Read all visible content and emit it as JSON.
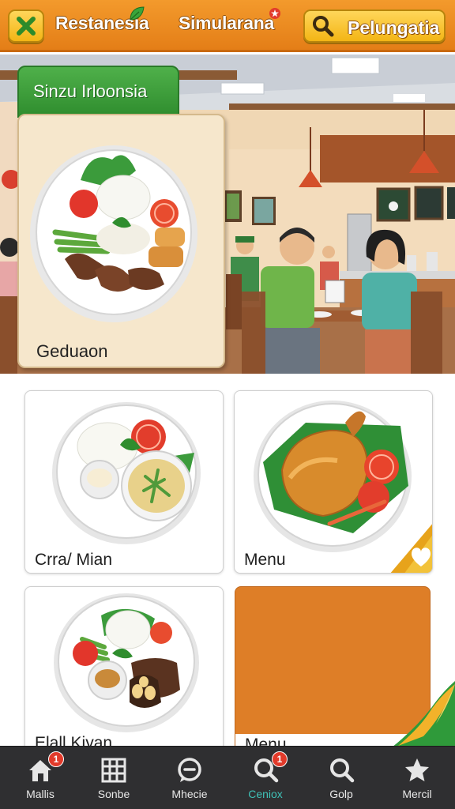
{
  "header": {
    "close_icon": "close-x-icon",
    "title_left": "Restanesia",
    "title_center": "Simularana",
    "search_label": "Pelungatia",
    "search_icon": "search-icon",
    "accent": "#e8861f",
    "button_color": "#f3b515"
  },
  "hero": {
    "tab_label": "Sinzu Irloonsia",
    "card_caption": "Geduaon",
    "tab_color": "#3c9e3a"
  },
  "grid": {
    "cards": [
      {
        "caption": "Crra/ Mian",
        "icon": "rice-plate-icon"
      },
      {
        "caption": "Menu",
        "icon": "roast-chicken-icon",
        "corner_icon": "heart-icon"
      },
      {
        "caption": "Elall Kiyan",
        "icon": "satay-plate-icon"
      },
      {
        "caption": "Menu",
        "color": "#de7e27"
      }
    ]
  },
  "nav": {
    "items": [
      {
        "label": "Mallis",
        "icon": "home-icon",
        "badge": "1"
      },
      {
        "label": "Sonbe",
        "icon": "grid-icon"
      },
      {
        "label": "Mhecie",
        "icon": "chat-icon"
      },
      {
        "label": "Ceniox",
        "icon": "search-icon",
        "badge": "1",
        "active": true
      },
      {
        "label": "Golp",
        "icon": "search-icon"
      },
      {
        "label": "Mercil",
        "icon": "star-icon"
      }
    ],
    "active_color": "#3fc1b7"
  }
}
